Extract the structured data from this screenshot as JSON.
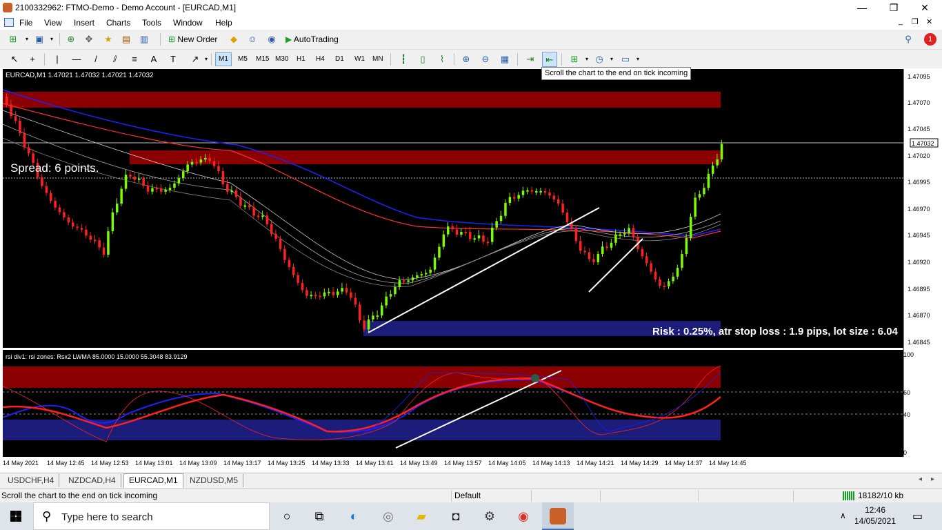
{
  "window": {
    "title": "2100332962: FTMO-Demo - Demo Account - [EURCAD,M1]",
    "minimize": "—",
    "restore": "❐",
    "close": "✕"
  },
  "menu": [
    "File",
    "View",
    "Insert",
    "Charts",
    "Tools",
    "Window",
    "Help"
  ],
  "toolbar": {
    "new_order": "New Order",
    "autotrading": "AutoTrading",
    "timeframes": [
      "M1",
      "M5",
      "M15",
      "M30",
      "H1",
      "H4",
      "D1",
      "W1",
      "MN"
    ],
    "active_timeframe": "M1",
    "tooltip": "Scroll the chart to the end on tick incoming",
    "notification_count": "1"
  },
  "chart": {
    "header": "EURCAD,M1  1.47021 1.47032 1.47021 1.47032",
    "spread_text": "Spread: 6 points.",
    "risk_text": "Risk : 0.25%, atr stop loss : 1.9 pips, lot size : 6.04",
    "current_price": "1.47032",
    "price_labels": [
      "1.47095",
      "1.47070",
      "1.47045",
      "1.47020",
      "1.46995",
      "1.46970",
      "1.46945",
      "1.46920",
      "1.46895",
      "1.46870",
      "1.46845"
    ],
    "indicator_header": "rsi div1: rsi zones: Rsx2 LWMA 85.0000 15.0000 55.3048 83.9129",
    "indicator_labels": [
      "100",
      "60",
      "40",
      "0"
    ],
    "time_labels": [
      "14 May 2021",
      "14 May 12:45",
      "14 May 12:53",
      "14 May 13:01",
      "14 May 13:09",
      "14 May 13:17",
      "14 May 13:25",
      "14 May 13:33",
      "14 May 13:41",
      "14 May 13:49",
      "14 May 13:57",
      "14 May 14:05",
      "14 May 14:13",
      "14 May 14:21",
      "14 May 14:29",
      "14 May 14:37",
      "14 May 14:45"
    ],
    "colors": {
      "bull": "#7cfc00",
      "bear": "#ff2020",
      "supply_zone": "#8b0000",
      "demand_zone": "#1c1c7a",
      "ma_blue": "#2020ff",
      "ma_red": "#ff3030"
    }
  },
  "tabs": [
    {
      "label": "USDCHF,H4",
      "active": false
    },
    {
      "label": "NZDCAD,H4",
      "active": false
    },
    {
      "label": "EURCAD,M1",
      "active": true
    },
    {
      "label": "NZDUSD,M5",
      "active": false
    }
  ],
  "status": {
    "message": "Scroll the chart to the end on tick incoming",
    "profile": "Default",
    "traffic": "18182/10 kb"
  },
  "taskbar": {
    "search_placeholder": "Type here to search",
    "time": "12:46",
    "date": "14/05/2021"
  }
}
